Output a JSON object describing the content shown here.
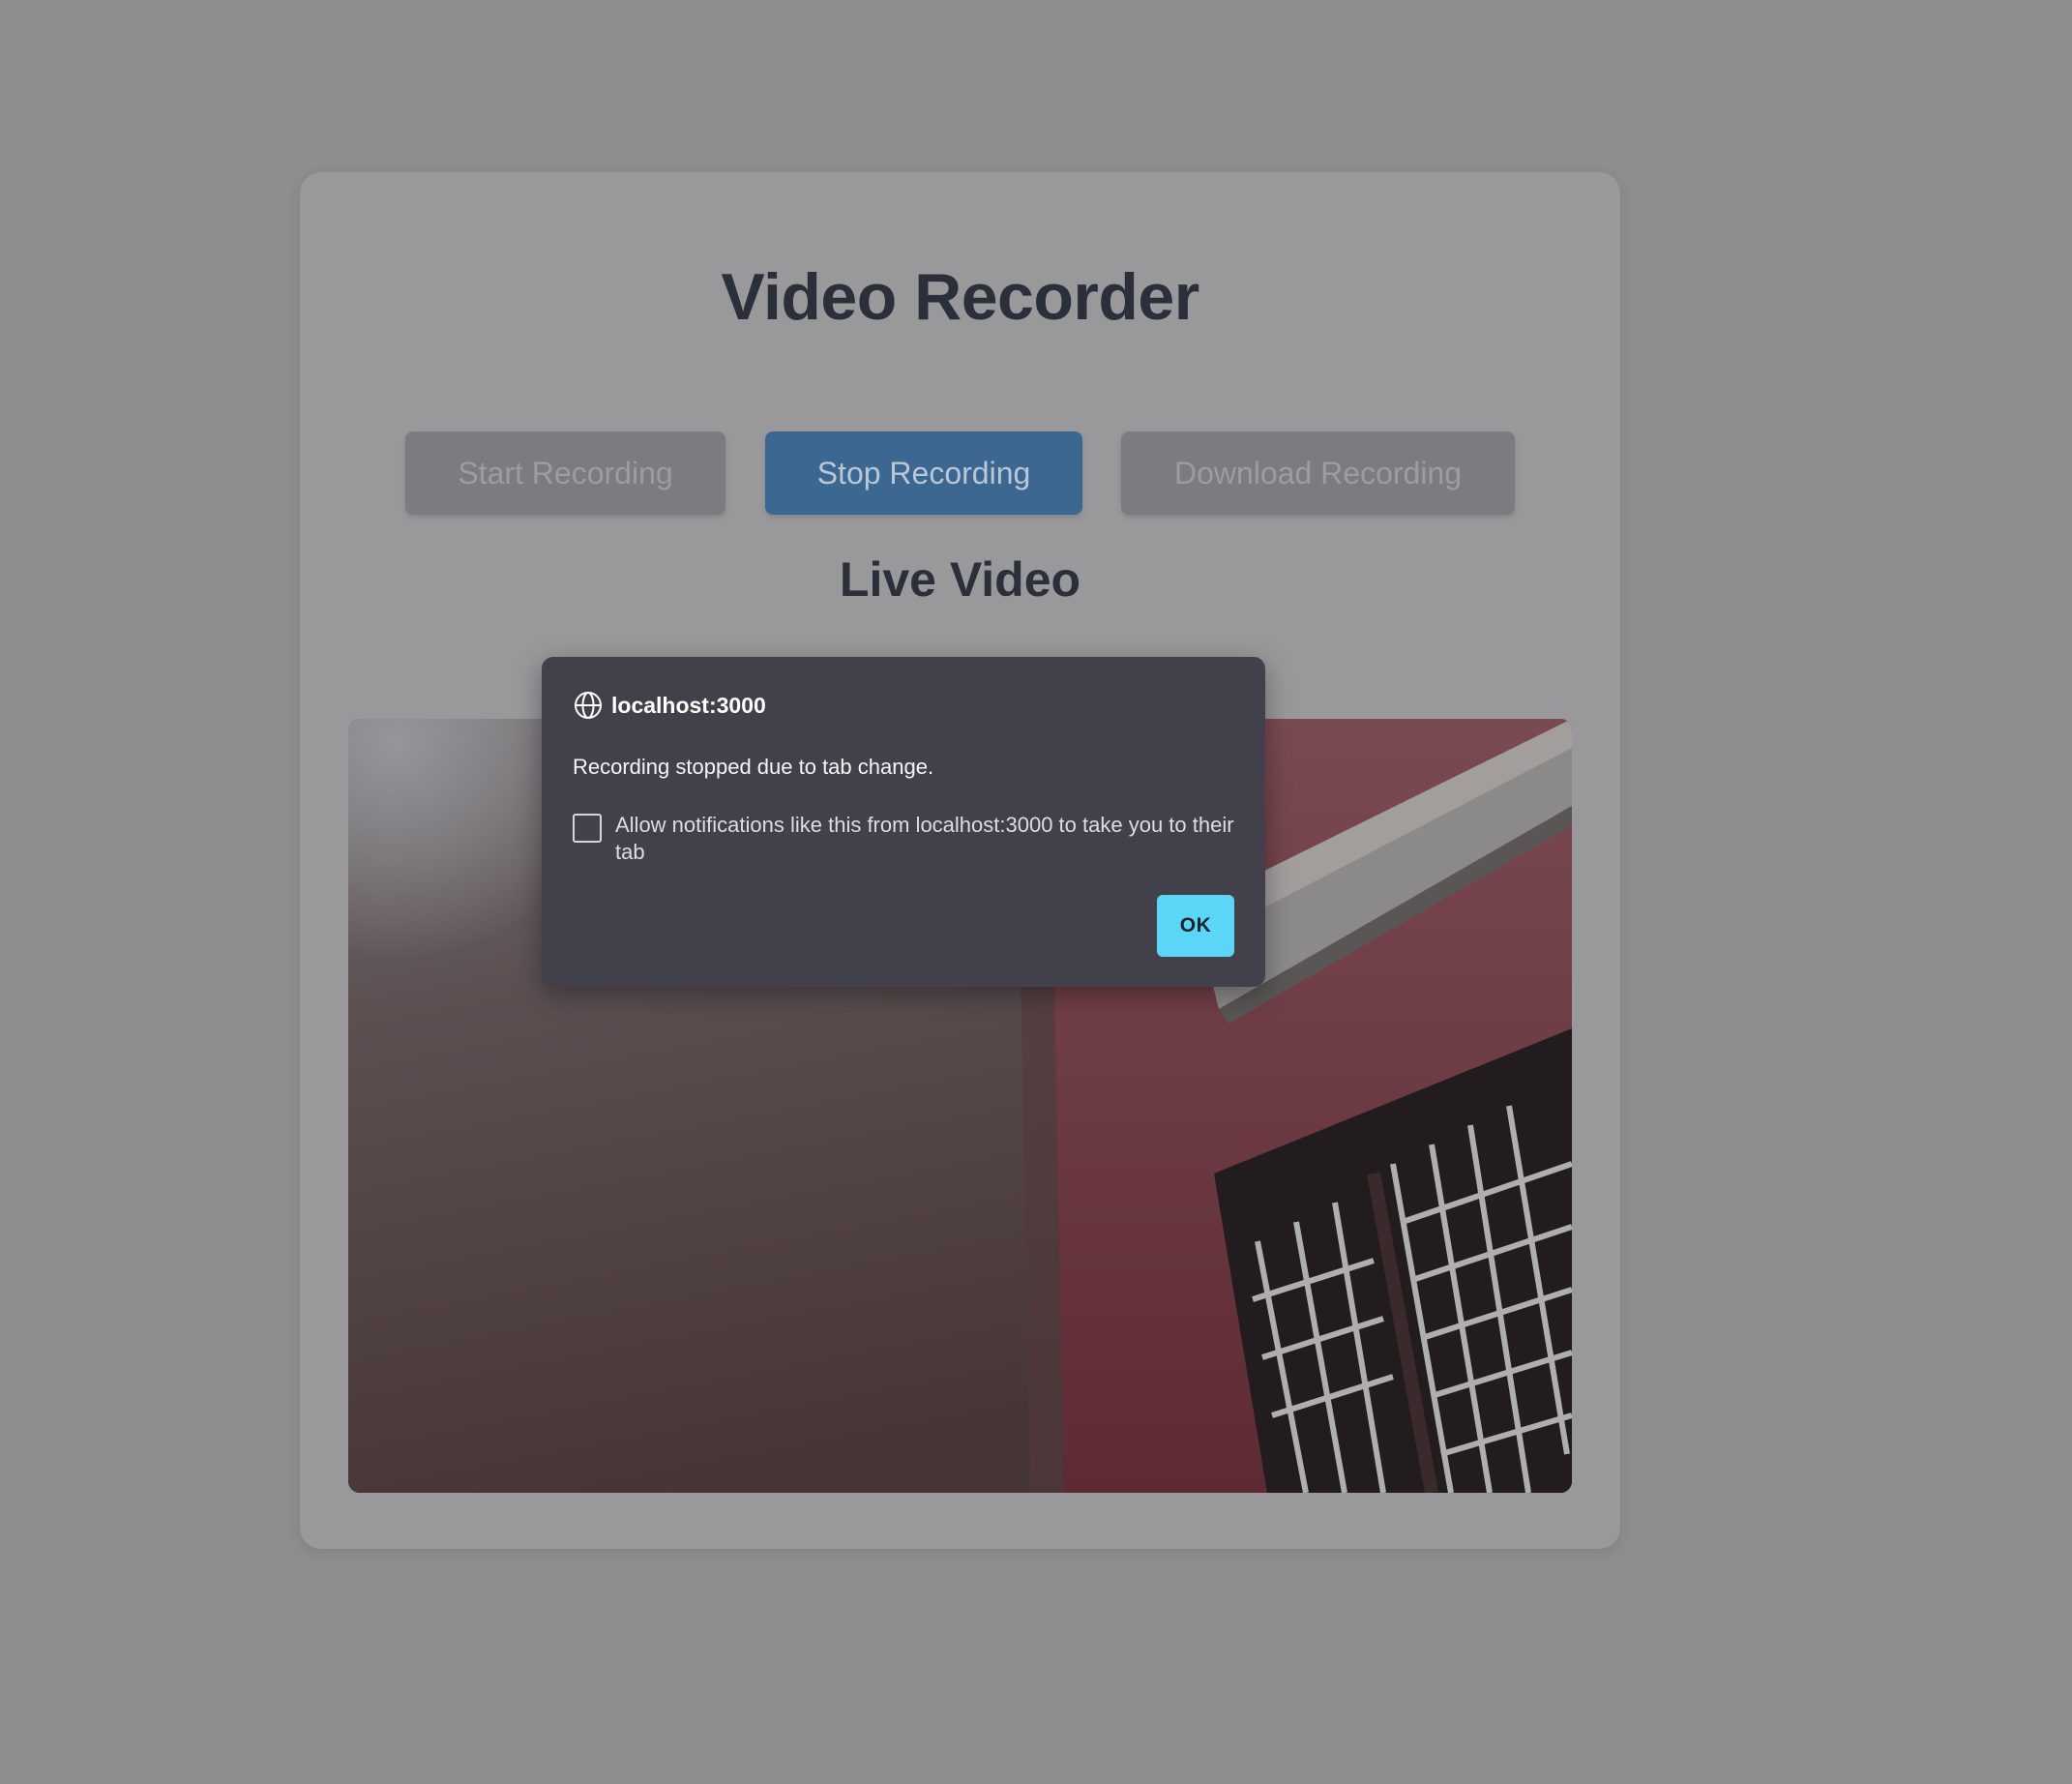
{
  "app": {
    "title": "Video Recorder",
    "section_title": "Live Video"
  },
  "controls": {
    "start_label": "Start Recording",
    "stop_label": "Stop Recording",
    "download_label": "Download Recording"
  },
  "video": {
    "icon": "video-feed-image"
  },
  "dialog": {
    "origin": "localhost:3000",
    "origin_icon": "globe-icon",
    "message": "Recording stopped due to tab change.",
    "checkbox_label": "Allow notifications like this from localhost:3000 to take you to their tab",
    "checkbox_checked": false,
    "ok_label": "OK"
  },
  "colors": {
    "overlay_bg": "#8e8e90",
    "card_bg": "#99999b",
    "stop_button": "#3c6791",
    "dialog_bg": "#42404b",
    "ok_button": "#5bd6f7"
  }
}
